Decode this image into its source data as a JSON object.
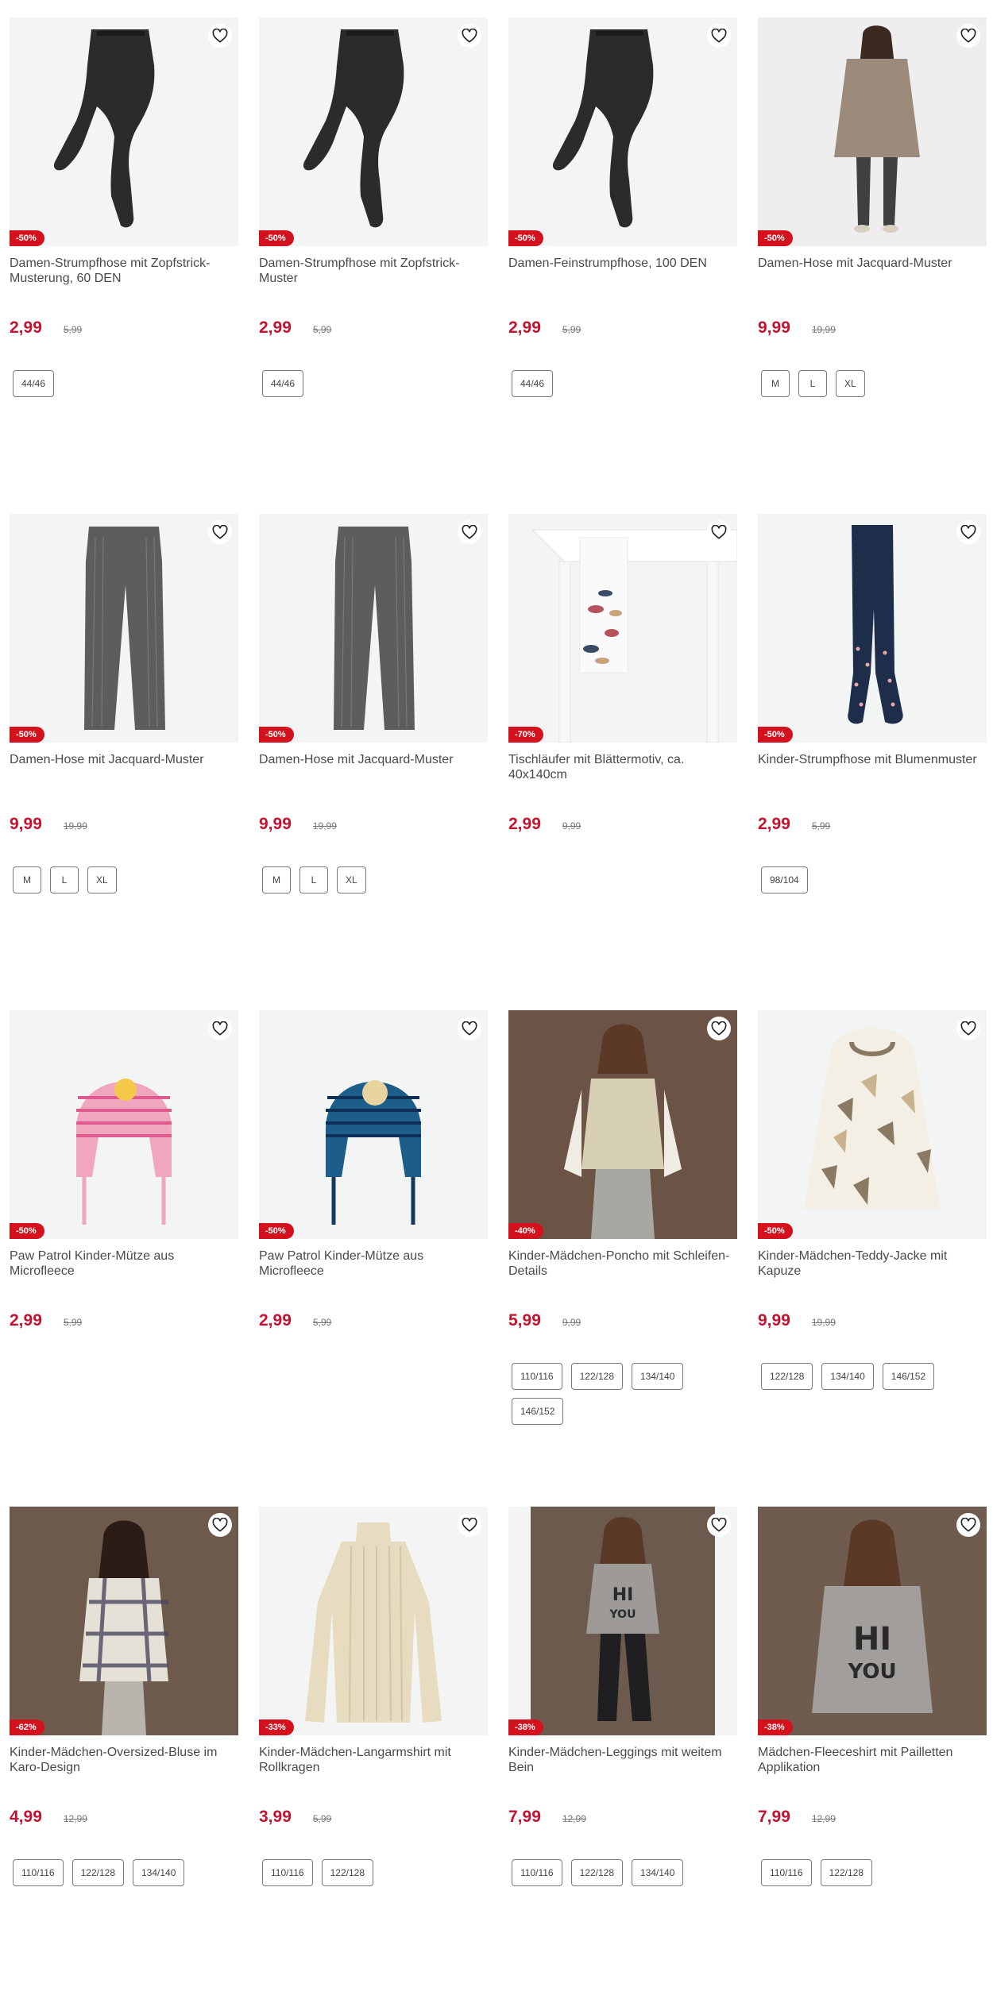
{
  "products": [
    {
      "name": "Damen-Strumpfhose mit Zopfstrick-Musterung, 60 DEN",
      "discount": "-50%",
      "price": "2,99",
      "old_price": "5,99",
      "sizes": [
        "44/46"
      ],
      "art": "tights",
      "bg": "#f3f5f5"
    },
    {
      "name": "Damen-Strumpfhose mit Zopfstrick-Muster",
      "discount": "-50%",
      "price": "2,99",
      "old_price": "5,99",
      "sizes": [
        "44/46"
      ],
      "art": "tights",
      "bg": "#f3f5f5"
    },
    {
      "name": "Damen-Feinstrumpfhose, 100 DEN",
      "discount": "-50%",
      "price": "2,99",
      "old_price": "5,99",
      "sizes": [
        "44/46"
      ],
      "art": "tights",
      "bg": "#f3f5f5"
    },
    {
      "name": "Damen-Hose mit Jacquard-Muster",
      "discount": "-50%",
      "price": "9,99",
      "old_price": "19,99",
      "sizes": [
        "M",
        "L",
        "XL"
      ],
      "art": "woman",
      "bg": "#eeeeef"
    },
    {
      "name": "Damen-Hose mit Jacquard-Muster",
      "discount": "-50%",
      "price": "9,99",
      "old_price": "19,99",
      "sizes": [
        "M",
        "L",
        "XL"
      ],
      "art": "trousers",
      "bg": "#f3f5f5"
    },
    {
      "name": "Damen-Hose mit Jacquard-Muster",
      "discount": "-50%",
      "price": "9,99",
      "old_price": "19,99",
      "sizes": [
        "M",
        "L",
        "XL"
      ],
      "art": "trousers",
      "bg": "#f3f5f5"
    },
    {
      "name": "Tischläufer mit Blättermotiv, ca. 40x140cm",
      "discount": "-70%",
      "price": "2,99",
      "old_price": "9,99",
      "sizes": [],
      "art": "table",
      "bg": "#f3f5f5"
    },
    {
      "name": "Kinder-Strumpfhose mit Blumenmuster",
      "discount": "-50%",
      "price": "2,99",
      "old_price": "5,99",
      "sizes": [
        "98/104"
      ],
      "art": "kidtights",
      "bg": "#f3f5f5"
    },
    {
      "name": "Paw Patrol Kinder-Mütze aus Microfleece",
      "discount": "-50%",
      "price": "2,99",
      "old_price": "5,99",
      "sizes": [],
      "art": "hat-pink",
      "bg": "#f3f5f5"
    },
    {
      "name": "Paw Patrol Kinder-Mütze aus Microfleece",
      "discount": "-50%",
      "price": "2,99",
      "old_price": "5,99",
      "sizes": [],
      "art": "hat-blue",
      "bg": "#f3f5f5"
    },
    {
      "name": "Kinder-Mädchen-Poncho mit Schleifen-Details",
      "discount": "-40%",
      "price": "5,99",
      "old_price": "9,99",
      "sizes": [
        "110/116",
        "122/128",
        "134/140",
        "146/152"
      ],
      "art": "girl-poncho",
      "bg": "#6b5446"
    },
    {
      "name": "Kinder-Mädchen-Teddy-Jacke mit Kapuze",
      "discount": "-50%",
      "price": "9,99",
      "old_price": "19,99",
      "sizes": [
        "122/128",
        "134/140",
        "146/152"
      ],
      "art": "teddy",
      "bg": "#f3f5f5"
    },
    {
      "name": "Kinder-Mädchen-Oversized-Bluse im Karo-Design",
      "discount": "-62%",
      "price": "4,99",
      "old_price": "12,99",
      "sizes": [
        "110/116",
        "122/128",
        "134/140"
      ],
      "art": "girl-plaid",
      "bg": "#6d5a4c"
    },
    {
      "name": "Kinder-Mädchen-Langarmshirt mit Rollkragen",
      "discount": "-33%",
      "price": "3,99",
      "old_price": "5,99",
      "sizes": [
        "110/116",
        "122/128"
      ],
      "art": "turtleneck",
      "bg": "#f3f5f5"
    },
    {
      "name": "Kinder-Mädchen-Leggings mit weitem Bein",
      "discount": "-38%",
      "price": "7,99",
      "old_price": "12,99",
      "sizes": [
        "110/116",
        "122/128",
        "134/140"
      ],
      "art": "girl-hi-full",
      "bg": "#6b5a4d"
    },
    {
      "name": "Mädchen-Fleeceshirt mit Pailletten Applikation",
      "discount": "-38%",
      "price": "7,99",
      "old_price": "12,99",
      "sizes": [
        "110/116",
        "122/128"
      ],
      "art": "girl-hi",
      "bg": "#6f5c4f"
    }
  ],
  "icons": {
    "wishlist": "heart-outline-icon"
  },
  "colors": {
    "discount_badge": "#d4121e",
    "price": "#c4122f",
    "text": "#4a4a4a"
  }
}
